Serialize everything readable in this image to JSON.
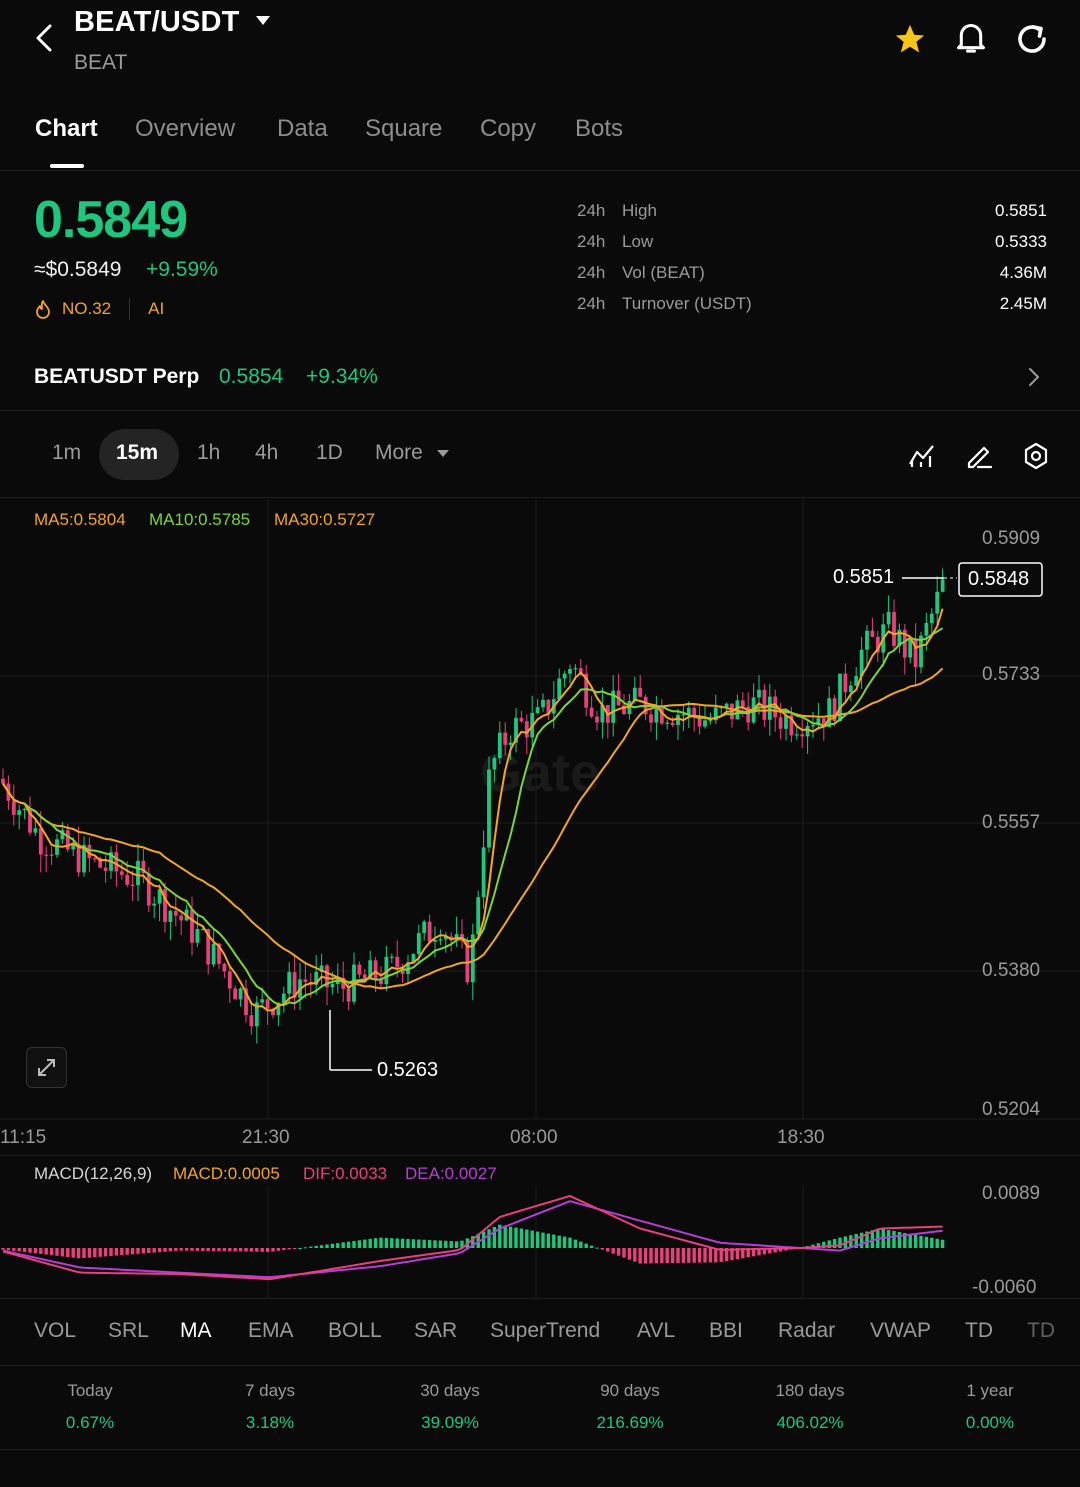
{
  "header": {
    "title": "BEAT/USDT",
    "subtitle": "BEAT"
  },
  "tabs": [
    "Chart",
    "Overview",
    "Data",
    "Square",
    "Copy",
    "Bots"
  ],
  "price": {
    "last": "0.5849",
    "usd": "≈$0.5849",
    "change": "+9.59%",
    "rank": "NO.32",
    "tag": "AI"
  },
  "stats": [
    {
      "period": "24h",
      "label": "High",
      "value": "0.5851"
    },
    {
      "period": "24h",
      "label": "Low",
      "value": "0.5333"
    },
    {
      "period": "24h",
      "label": "Vol (BEAT)",
      "value": "4.36M"
    },
    {
      "period": "24h",
      "label": "Turnover (USDT)",
      "value": "2.45M"
    }
  ],
  "perp": {
    "name": "BEATUSDT Perp",
    "price": "0.5854",
    "change": "+9.34%"
  },
  "intervals": [
    "1m",
    "15m",
    "1h",
    "4h",
    "1D",
    "More"
  ],
  "chart": {
    "ma5": "MA5:0.5804",
    "ma10": "MA10:0.5785",
    "ma30": "MA30:0.5727",
    "yticks": [
      "0.5909",
      "0.5733",
      "0.5557",
      "0.5380",
      "0.5204"
    ],
    "xticks": [
      "11:15",
      "21:30",
      "08:00",
      "18:30"
    ],
    "high_label": "0.5851",
    "low_label": "0.5263",
    "current_price": "0.5848",
    "watermark": "Gate"
  },
  "macd": {
    "name": "MACD(12,26,9)",
    "macd": "MACD:0.0005",
    "dif": "DIF:0.0033",
    "dea": "DEA:0.0027",
    "ymax": "0.0089",
    "ymin": "-0.0060"
  },
  "indicators": [
    "VOL",
    "SRL",
    "MA",
    "EMA",
    "BOLL",
    "SAR",
    "SuperTrend",
    "AVL",
    "BBI",
    "Radar",
    "VWAP",
    "TD",
    "TD"
  ],
  "performance": [
    {
      "label": "Today",
      "value": "0.67%"
    },
    {
      "label": "7 days",
      "value": "3.18%"
    },
    {
      "label": "30 days",
      "value": "39.09%"
    },
    {
      "label": "90 days",
      "value": "216.69%"
    },
    {
      "label": "180 days",
      "value": "406.02%"
    },
    {
      "label": "1 year",
      "value": "0.00%"
    }
  ],
  "colors": {
    "up": "#1fc77e",
    "down": "#e8407a",
    "ma5": "#f0a52a",
    "ma10": "#7bd43c",
    "ma30": "#f0a52a",
    "dea": "#b53fd1",
    "star": "#f5c518"
  }
}
